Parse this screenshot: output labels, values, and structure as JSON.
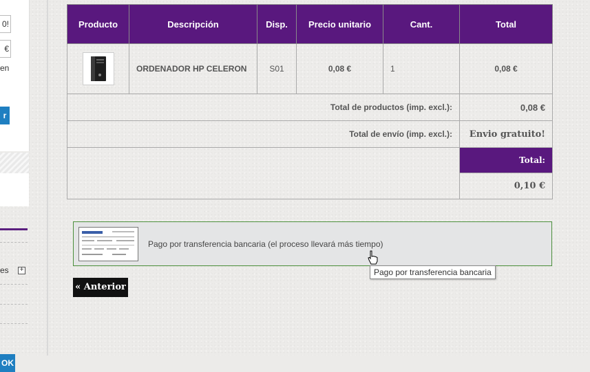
{
  "sidebar": {
    "field1_value": "0!",
    "field2_value": "€",
    "text": "en",
    "button_label": "r",
    "ok_label": "OK",
    "category_label": "es",
    "expand_label": "+"
  },
  "cart": {
    "headers": [
      "Producto",
      "Descripción",
      "Disp.",
      "Precio unitario",
      "Cant.",
      "Total"
    ],
    "items": [
      {
        "image_icon": "desktop-computer",
        "description": "ORDENADOR HP CELERON",
        "availability": "S01",
        "unit_price": "0,08 €",
        "quantity": "1",
        "total": "0,08 €"
      }
    ],
    "products_total_label": "Total de productos (imp. excl.):",
    "products_total_value": "0,08 €",
    "shipping_label": "Total de envío (imp. excl.):",
    "shipping_value": "Envio gratuito!",
    "grand_total_label": "Total:",
    "grand_total_value": "0,10 €"
  },
  "payment": {
    "option_label": "Pago por transferencia bancaria (el proceso llevará más tiempo)",
    "tooltip": "Pago por transferencia bancaria"
  },
  "nav": {
    "back_label": "« Anterior"
  },
  "colors": {
    "header_purple": "#59187e",
    "payment_border": "#4a8e3a",
    "button_blue": "#1f7fc1"
  }
}
